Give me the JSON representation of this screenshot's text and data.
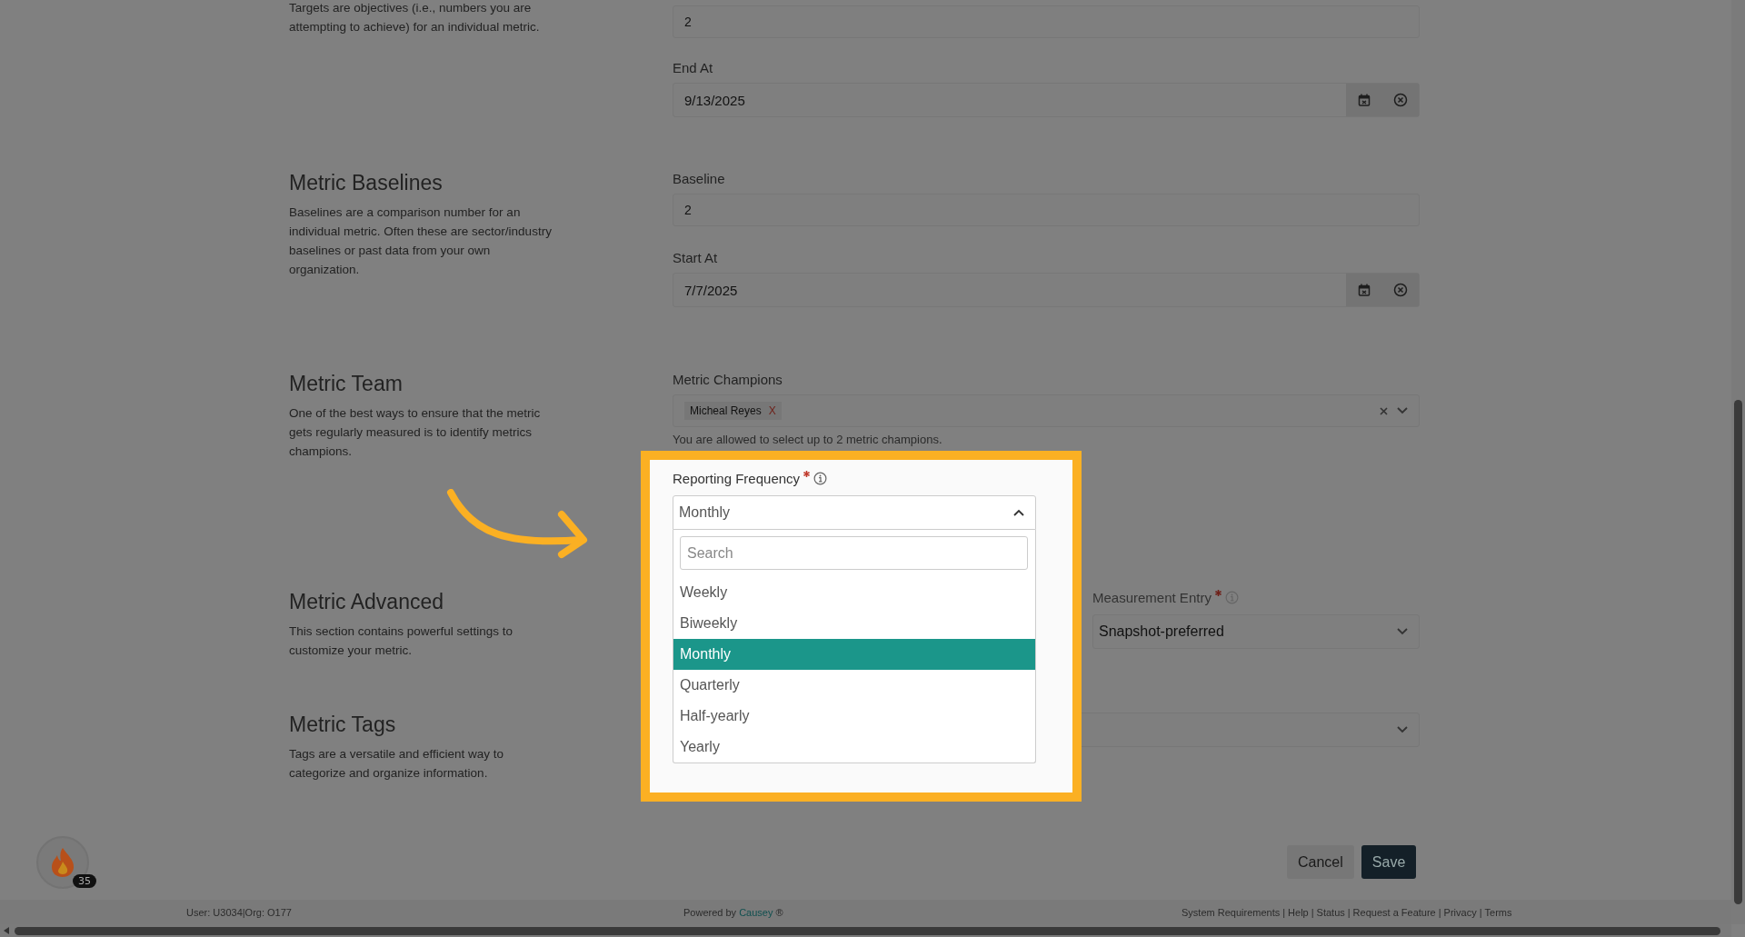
{
  "targets": {
    "description": "Targets are objectives (i.e., numbers you are attempting to achieve) for an individual metric.",
    "value_field": {
      "value": "2"
    },
    "end_at": {
      "label": "End At",
      "value": "9/13/2025"
    }
  },
  "baselines": {
    "title": "Metric Baselines",
    "description": "Baselines are a comparison number for an individual metric. Often these are sector/industry baselines or past data from your own organization.",
    "baseline": {
      "label": "Baseline",
      "value": "2"
    },
    "start_at": {
      "label": "Start At",
      "value": "7/7/2025"
    }
  },
  "team": {
    "title": "Metric Team",
    "description": "One of the best ways to ensure that the metric gets regularly measured is to identify metrics champions.",
    "champions": {
      "label": "Metric Champions",
      "tags": [
        {
          "label": "Micheal Reyes",
          "remove": "X"
        }
      ],
      "hint": "You are allowed to select up to 2 metric champions."
    },
    "reporting_frequency": {
      "label": "Reporting Frequency",
      "required": true,
      "value": "Monthly",
      "expanded": true,
      "search_placeholder": "Search",
      "options": [
        {
          "label": "Weekly",
          "selected": false
        },
        {
          "label": "Biweekly",
          "selected": false
        },
        {
          "label": "Monthly",
          "selected": true
        },
        {
          "label": "Quarterly",
          "selected": false
        },
        {
          "label": "Half-yearly",
          "selected": false
        },
        {
          "label": "Yearly",
          "selected": false
        }
      ]
    }
  },
  "advanced": {
    "title": "Metric Advanced",
    "description": "This section contains powerful settings to customize your metric.",
    "measurement_entry": {
      "label": "Measurement Entry",
      "required": true,
      "value": "Snapshot-preferred"
    }
  },
  "tags": {
    "title": "Metric Tags",
    "description": "Tags are a versatile and efficient way to categorize and organize information."
  },
  "actions": [
    {
      "label": "Cancel",
      "kind": "secondary"
    },
    {
      "label": "Save",
      "kind": "primary"
    }
  ],
  "badge": {
    "count": "35"
  },
  "footer": {
    "user": "User: U3034|Org: O177",
    "powered_by": "Powered by",
    "brand": "Causey",
    "brand_mark": "®",
    "links": [
      "System Requirements",
      "Help",
      "Status",
      "Request a Feature",
      "Privacy",
      "Terms"
    ],
    "separator": "|"
  }
}
